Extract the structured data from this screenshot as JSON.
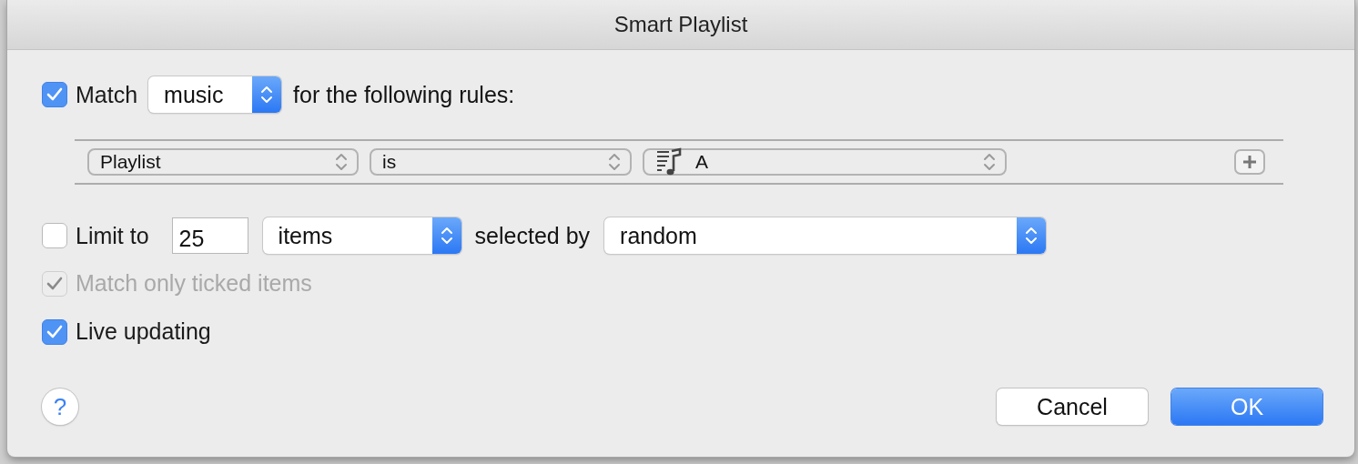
{
  "window": {
    "title": "Smart Playlist"
  },
  "match": {
    "checked": true,
    "label": "Match",
    "popup": {
      "value": "music",
      "kind": "accent"
    },
    "suffix": "for the following rules:"
  },
  "rules": [
    {
      "field": {
        "value": "Playlist",
        "kind": "plain"
      },
      "operator": {
        "value": "is",
        "kind": "plain"
      },
      "target": {
        "value": "A",
        "kind": "plain"
      }
    }
  ],
  "limit": {
    "checked": false,
    "label": "Limit to",
    "value": "25",
    "unit": {
      "value": "items",
      "kind": "accent"
    },
    "selected_by_label": "selected by",
    "selected_by": {
      "value": "random",
      "kind": "accent"
    }
  },
  "options": [
    {
      "label": "Match only ticked items",
      "checked": true,
      "disabled": true
    },
    {
      "label": "Live updating",
      "checked": true,
      "disabled": false
    }
  ],
  "help": "?",
  "buttons": [
    {
      "label": "Cancel",
      "default": false
    },
    {
      "label": "OK",
      "default": true
    }
  ]
}
